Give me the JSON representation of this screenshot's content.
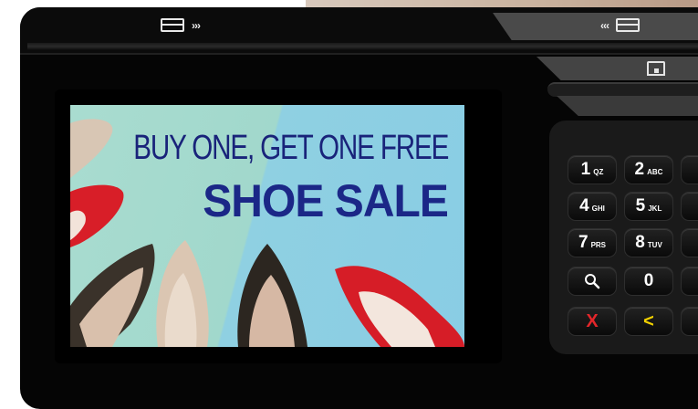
{
  "device": {
    "card_reader_left_arrows": "›››",
    "card_reader_right_arrows": "‹‹‹",
    "card_icon": "card-icon",
    "chip_icon": "chip-card-icon"
  },
  "screen": {
    "headline_line1": "BUY ONE, GET ONE FREE",
    "headline_line2": "SHOE SALE"
  },
  "keypad": {
    "keys": [
      {
        "num": "1",
        "letters": "QZ"
      },
      {
        "num": "2",
        "letters": "ABC"
      },
      {
        "num": "4",
        "letters": "GHI"
      },
      {
        "num": "5",
        "letters": "JKL"
      },
      {
        "num": "7",
        "letters": "PRS"
      },
      {
        "num": "8",
        "letters": "TUV"
      },
      {
        "num": "0",
        "letters": ""
      }
    ],
    "search_icon": "search-icon",
    "cancel_symbol": "X",
    "back_symbol": "<"
  },
  "colors": {
    "cancel": "#e3262a",
    "back": "#f2d100",
    "headline": "#1b2787"
  }
}
